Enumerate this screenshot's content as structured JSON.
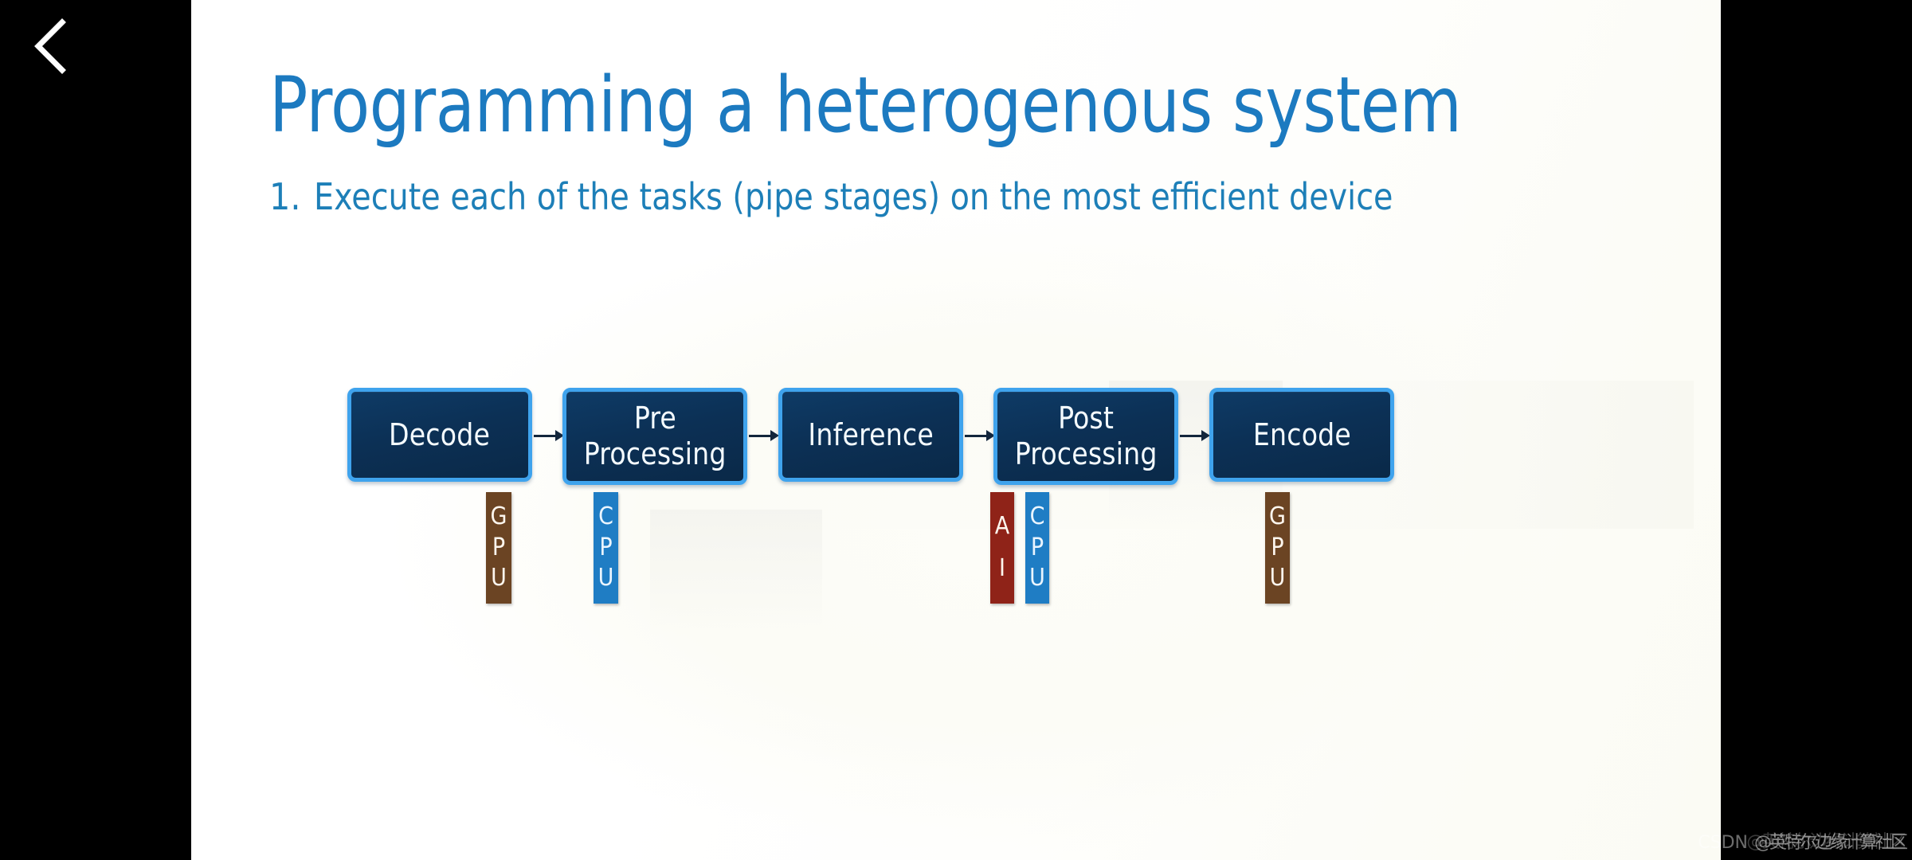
{
  "player": {
    "back_icon": "chevron-left-icon"
  },
  "slide": {
    "title": "Programming a heterogenous system",
    "list": [
      {
        "number": "1.",
        "text": "Execute each of the tasks (pipe stages) on the most efficient device"
      }
    ],
    "colors": {
      "title_blue": "#1c7ac0",
      "body_blue": "#1d7fb8",
      "box_fill": "#0c3055",
      "box_border": "#3fa3ed",
      "arrow": "#13263c",
      "gpu_brown": "#6b4423",
      "cpu_blue": "#1f7dc4",
      "ai_red": "#8f2318",
      "slide_bg": "#ffffff",
      "letterbox": "#000000"
    },
    "pipeline": {
      "stages": [
        {
          "label": "Decode",
          "lines": [
            "Decode"
          ],
          "device": "GPU",
          "device_color": "#6b4423"
        },
        {
          "label": "Pre Processing",
          "lines": [
            "Pre",
            "Processing"
          ],
          "device": "CPU",
          "device_color": "#1f7dc4"
        },
        {
          "label": "Inference",
          "lines": [
            "Inference"
          ],
          "device": "AI",
          "device_color": "#8f2318"
        },
        {
          "label": "Post Processing",
          "lines": [
            "Post",
            "Processing"
          ],
          "device": "CPU",
          "device_color": "#1f7dc4"
        },
        {
          "label": "Encode",
          "lines": [
            "Encode"
          ],
          "device": "GPU",
          "device_color": "#6b4423"
        }
      ],
      "connector_count": 4,
      "connector_icon": "arrow-right-icon"
    }
  },
  "watermark": {
    "site": "CSDN",
    "author": "@英特尔边缘计算社区"
  }
}
